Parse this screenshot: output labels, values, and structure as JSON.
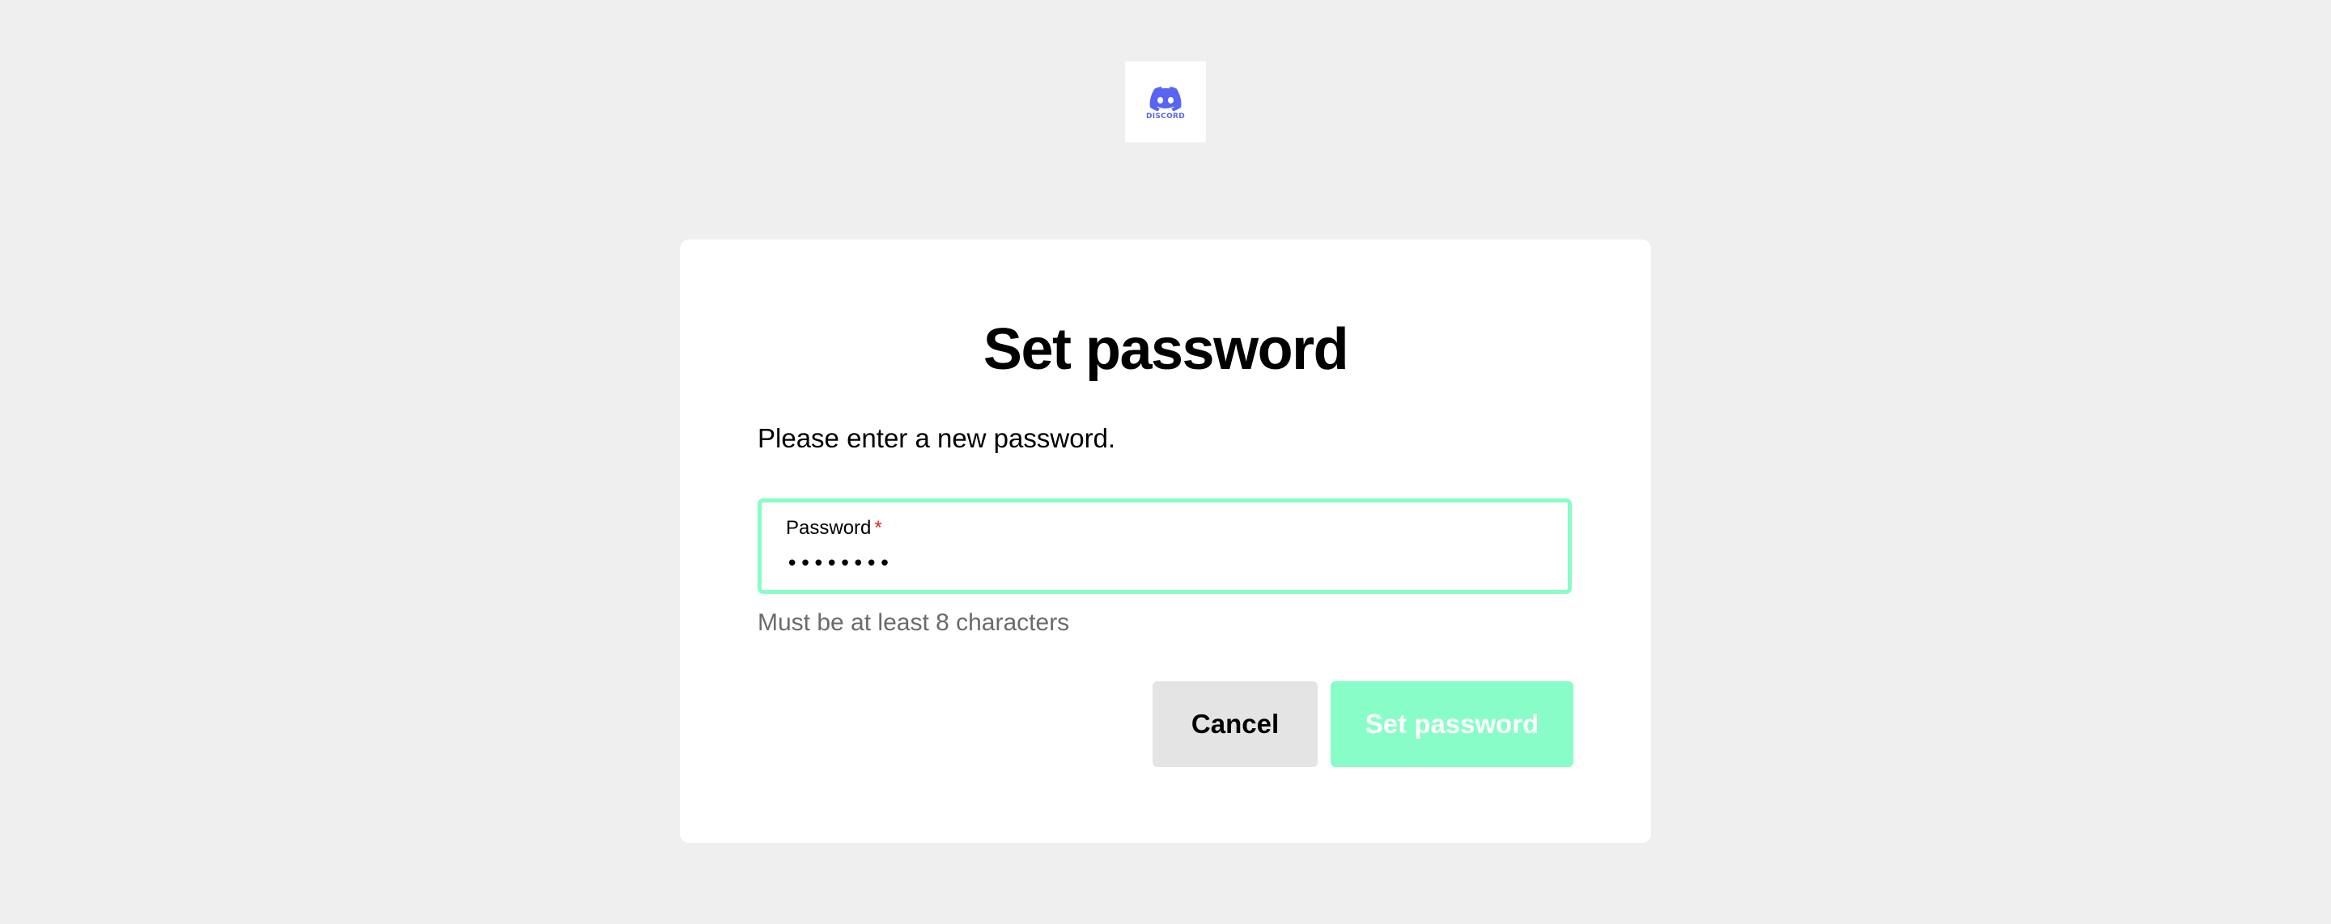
{
  "brand": {
    "logo_icon": "discord-icon",
    "wordmark": "DISCORD",
    "color": "#5865f2"
  },
  "form": {
    "title": "Set password",
    "subtitle": "Please enter a new password.",
    "password_field": {
      "label": "Password",
      "required_marker": "*",
      "value": "........",
      "masked_display": "••••••••"
    },
    "helper_text": "Must be at least 8 characters",
    "cancel_label": "Cancel",
    "submit_label": "Set password"
  },
  "colors": {
    "background": "#efefef",
    "card": "#ffffff",
    "accent": "#89fdc7",
    "required": "#e0271d",
    "helper": "#6b6b6b"
  }
}
